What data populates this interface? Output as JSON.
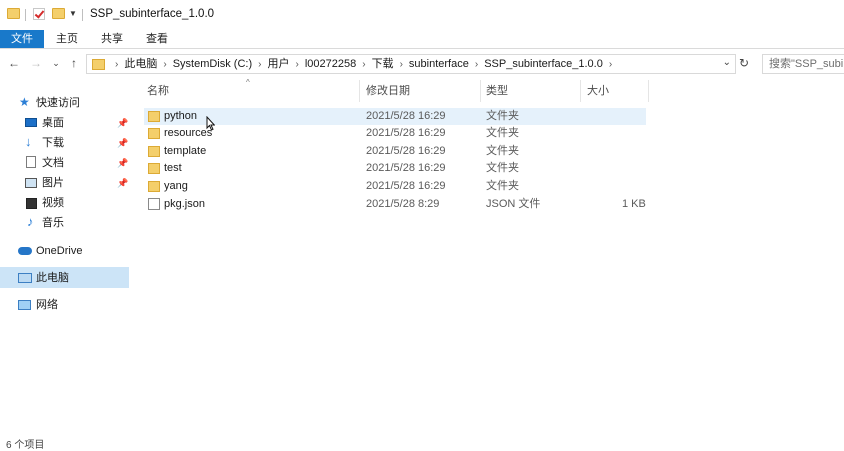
{
  "window": {
    "title": "SSP_subinterface_1.0.0"
  },
  "ribbon": {
    "tabs": [
      "文件",
      "主页",
      "共享",
      "查看"
    ]
  },
  "nav": {
    "back": "←",
    "forward": "→",
    "recent": "⌄",
    "up": "↑",
    "breadcrumb": [
      "此电脑",
      "SystemDisk (C:)",
      "用户",
      "l00272258",
      "下载",
      "subinterface",
      "SSP_subinterface_1.0.0"
    ],
    "refresh": "↻",
    "search_placeholder": "搜索\"SSP_subint"
  },
  "sidebar": {
    "quick_access": "快速访问",
    "items": [
      {
        "label": "桌面",
        "icon": "desktop-icon",
        "pinned": true
      },
      {
        "label": "下载",
        "icon": "download-icon",
        "pinned": true
      },
      {
        "label": "文档",
        "icon": "document-icon",
        "pinned": true
      },
      {
        "label": "图片",
        "icon": "picture-icon",
        "pinned": true
      },
      {
        "label": "视频",
        "icon": "video-icon",
        "pinned": false
      },
      {
        "label": "音乐",
        "icon": "music-icon",
        "pinned": false
      }
    ],
    "onedrive": "OneDrive",
    "this_pc": "此电脑",
    "network": "网络"
  },
  "columns": {
    "name": "名称",
    "modified": "修改日期",
    "type": "类型",
    "size": "大小"
  },
  "files": [
    {
      "name": "python",
      "modified": "2021/5/28 16:29",
      "type": "文件夹",
      "size": "",
      "kind": "folder"
    },
    {
      "name": "resources",
      "modified": "2021/5/28 16:29",
      "type": "文件夹",
      "size": "",
      "kind": "folder"
    },
    {
      "name": "template",
      "modified": "2021/5/28 16:29",
      "type": "文件夹",
      "size": "",
      "kind": "folder"
    },
    {
      "name": "test",
      "modified": "2021/5/28 16:29",
      "type": "文件夹",
      "size": "",
      "kind": "folder"
    },
    {
      "name": "yang",
      "modified": "2021/5/28 16:29",
      "type": "文件夹",
      "size": "",
      "kind": "folder"
    },
    {
      "name": "pkg.json",
      "modified": "2021/5/28 8:29",
      "type": "JSON 文件",
      "size": "1 KB",
      "kind": "file"
    }
  ],
  "status": {
    "text": "6 个项目"
  },
  "colors": {
    "accent": "#1979ca",
    "selection": "#cce4f7",
    "hover": "#e5f1fb",
    "folder": "#f4cf6b"
  }
}
